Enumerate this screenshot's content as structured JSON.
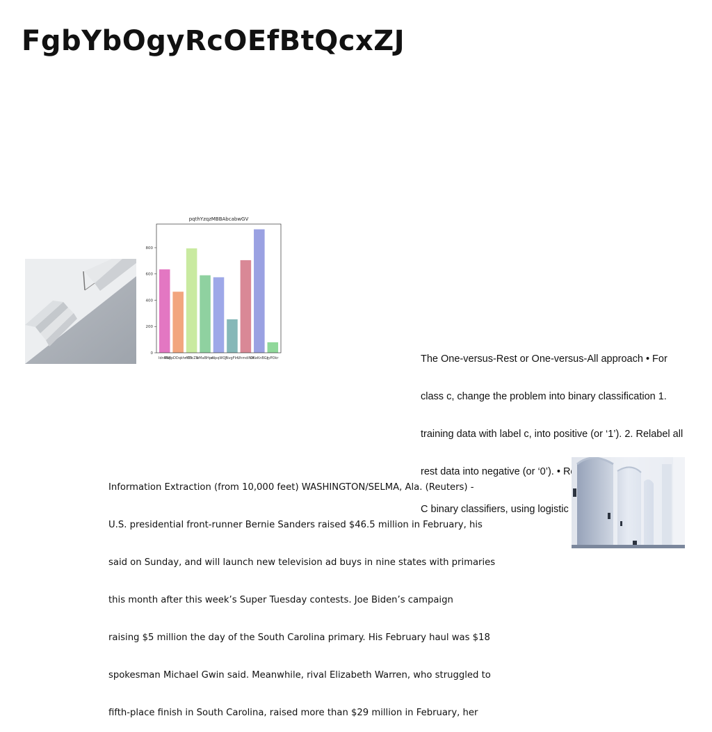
{
  "page": {
    "title": "FgbYbOgyRcOEfBtQcxZJ"
  },
  "chart_data": {
    "type": "bar",
    "title": "pqthYzqzMBBAbcabwGV",
    "categories": [
      "IdnKWJ",
      "MtdpDDqkhrYZI",
      "nlFtcZB",
      "eMaBHpa",
      "rNpqWQJ",
      "NvgFlrt",
      "UhmdiNH",
      "GKeKnBGr",
      "JyPOkr"
    ],
    "values": [
      635,
      465,
      795,
      590,
      575,
      255,
      705,
      940,
      80
    ],
    "colors": [
      "#e377c2",
      "#f2a57e",
      "#c9eaa0",
      "#8fd1a0",
      "#9ea8e8",
      "#86b8b8",
      "#d98896",
      "#9aa1e2",
      "#90d89a"
    ],
    "xlabel": "",
    "ylabel": "",
    "yticks": [
      0,
      200,
      400,
      600,
      800
    ],
    "ylim": [
      0,
      980
    ],
    "grid": false
  },
  "text_right": {
    "lines": [
      "The One-versus-Rest or One-versus-All approach • For",
      "class c, change the problem into binary classification 1.",
      "training data with label c, into positive (or ‘1’). 2. Relabel all",
      "rest data into negative (or ‘0’). • Repeat this multiple times:",
      "C binary classifiers, using logistic regression to differentiate"
    ]
  },
  "text_bottom": {
    "lines": [
      "Information Extraction (from 10,000 feet) WASHINGTON/SELMA, Ala. (Reuters) -",
      "U.S. presidential front-runner Bernie Sanders raised $46.5 million in February, his",
      "said on Sunday, and will launch new television ad buys in nine states with primaries",
      "this month after this week’s Super Tuesday contests. Joe Biden’s campaign",
      "raising $5 million the day of the South Carolina primary. His February haul was $18",
      "spokesman Michael Gwin said. Meanwhile, rival Elizabeth Warren, who struggled to",
      "fifth-place finish in South Carolina, raised more than $29 million in February, her"
    ]
  }
}
